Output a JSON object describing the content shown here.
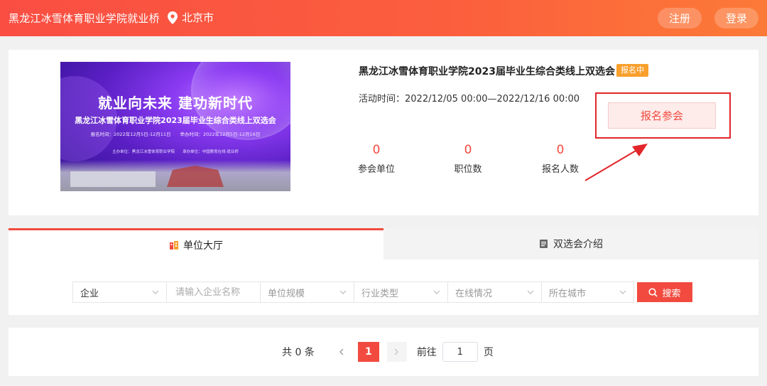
{
  "header": {
    "brand": "黑龙江冰雪体育职业学院就业桥",
    "location": "北京市",
    "register_label": "注册",
    "login_label": "登录"
  },
  "banner": {
    "title": "就业向未来 建功新时代",
    "subtitle": "黑龙江冰雪体育职业学院2023届毕业生综合类线上双选会",
    "times": "报名时间：2022年12月5日-12月11日　　举办时间：2022年12月5日-12月16日",
    "organizers": "主办单位：黑龙江冰雪体育职业学院　　承办单位：中国教育在线·就业桥"
  },
  "event": {
    "title": "黑龙江冰雪体育职业学院2023届毕业生综合类线上双选会",
    "status_badge": "报名中",
    "time": "活动时间：2022/12/05 00:00—2022/12/16 00:00",
    "register_button": "报名参会",
    "stats": [
      {
        "value": "0",
        "label": "参会单位"
      },
      {
        "value": "0",
        "label": "职位数"
      },
      {
        "value": "0",
        "label": "报名人数"
      }
    ]
  },
  "tabs": [
    {
      "label": "单位大厅",
      "icon": "building-icon",
      "active": true
    },
    {
      "label": "双选会介绍",
      "icon": "document-icon",
      "active": false
    }
  ],
  "filters": {
    "type": "企业",
    "name_placeholder": "请输入企业名称",
    "scale": "单位规模",
    "industry": "行业类型",
    "online": "在线情况",
    "city": "所在城市",
    "search_label": "搜索"
  },
  "pagination": {
    "total": "共 0 条",
    "current": "1",
    "goto_label": "前往",
    "goto_value": "1",
    "page_unit": "页"
  },
  "colors": {
    "accent": "#f24a3f",
    "badge": "#f9a02c",
    "annotation": "#e3262a"
  }
}
